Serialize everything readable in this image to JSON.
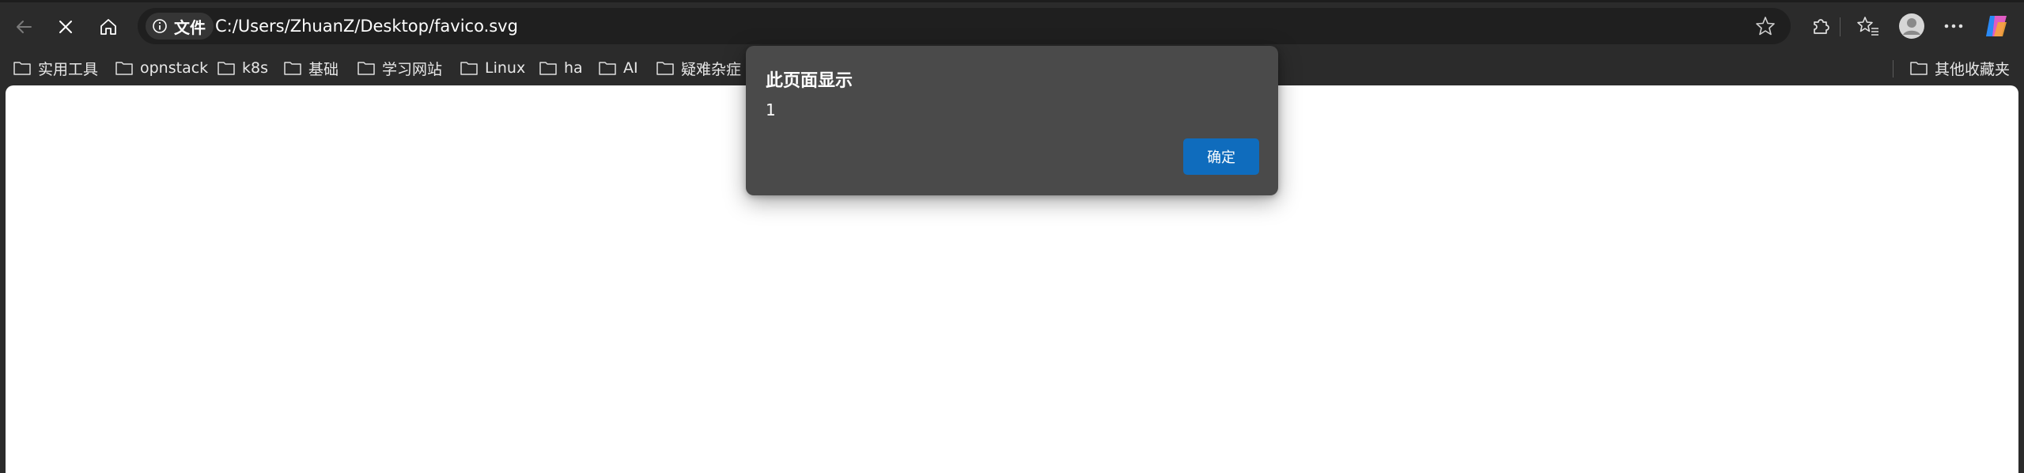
{
  "toolbar": {
    "back_icon": "back-arrow-icon",
    "stop_icon": "close-icon",
    "home_icon": "home-icon",
    "site_info_icon": "info-icon",
    "site_info_label": "文件",
    "url": "C:/Users/ZhuanZ/Desktop/favico.svg",
    "favorite_icon": "star-icon",
    "extensions_icon": "puzzle-icon",
    "favorites_icon": "favorites-icon",
    "profile_icon": "avatar-icon",
    "more_icon": "more-icon",
    "copilot_icon": "copilot-icon"
  },
  "bookmarks": {
    "items": [
      {
        "label": "实用工具"
      },
      {
        "label": "opnstack"
      },
      {
        "label": "k8s"
      },
      {
        "label": "基础"
      },
      {
        "label": "学习网站"
      },
      {
        "label": "Linux"
      },
      {
        "label": "ha"
      },
      {
        "label": "AI"
      },
      {
        "label": "疑难杂症"
      }
    ],
    "other_label": "其他收藏夹"
  },
  "dialog": {
    "title": "此页面显示",
    "message": "1",
    "ok_label": "确定"
  },
  "colors": {
    "chrome_bg": "#2b2b2b",
    "omnibox_bg": "#1f1f1f",
    "dialog_bg": "#4a4a4a",
    "accent": "#0f6cbd",
    "page_bg": "#ffffff"
  }
}
